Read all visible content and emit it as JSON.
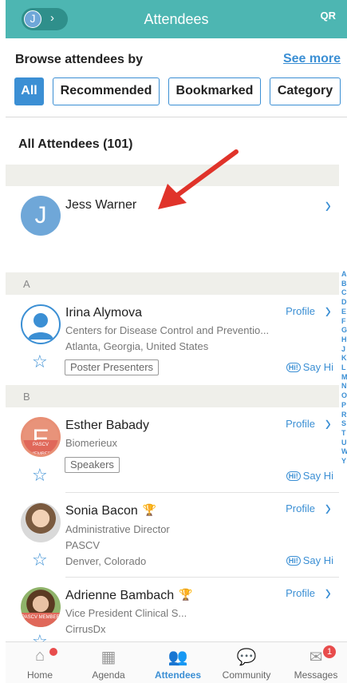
{
  "header": {
    "title": "Attendees",
    "avatar_initial": "J",
    "qr_label": "QR"
  },
  "browse": {
    "label": "Browse attendees by",
    "see_more": "See more",
    "filters": [
      "All",
      "Recommended",
      "Bookmarked",
      "Category"
    ]
  },
  "list": {
    "heading": "All Attendees (101)",
    "featured": {
      "initial": "J",
      "name": "Jess Warner"
    },
    "sections": [
      {
        "letter": "A"
      },
      {
        "letter": "B"
      }
    ],
    "attendees": [
      {
        "name": "Irina Alymova",
        "line1": "Centers for Disease Control and Preventio...",
        "line2": "Atlanta, Georgia, United States",
        "tag": "Poster Presenters"
      },
      {
        "name": "Esther Babady",
        "initial": "E",
        "line1": "Biomerieux",
        "tag": "Speakers",
        "badge": "PASCV MEMBER"
      },
      {
        "name": "Sonia Bacon",
        "line1": "Administrative Director",
        "line2": "PASCV",
        "line3": "Denver, Colorado"
      },
      {
        "name": "Adrienne Bambach",
        "line1": "Vice President Clinical S...",
        "line2": "CirrusDx",
        "badge": "PASCV MEMBER"
      }
    ],
    "profile_label": "Profile",
    "say_hi_label": "Say Hi",
    "hi_icon_text": "Hi!"
  },
  "alpha_index": [
    "A",
    "B",
    "C",
    "D",
    "E",
    "F",
    "G",
    "H",
    "J",
    "K",
    "L",
    "M",
    "N",
    "O",
    "P",
    "R",
    "S",
    "T",
    "U",
    "W",
    "Y"
  ],
  "nav": {
    "items": [
      "Home",
      "Agenda",
      "Attendees",
      "Community",
      "Messages"
    ],
    "active": "Attendees",
    "messages_badge": "1"
  },
  "colors": {
    "header_bg": "#4db6b2",
    "accent": "#3b8fd4",
    "arrow": "#e0332a"
  }
}
